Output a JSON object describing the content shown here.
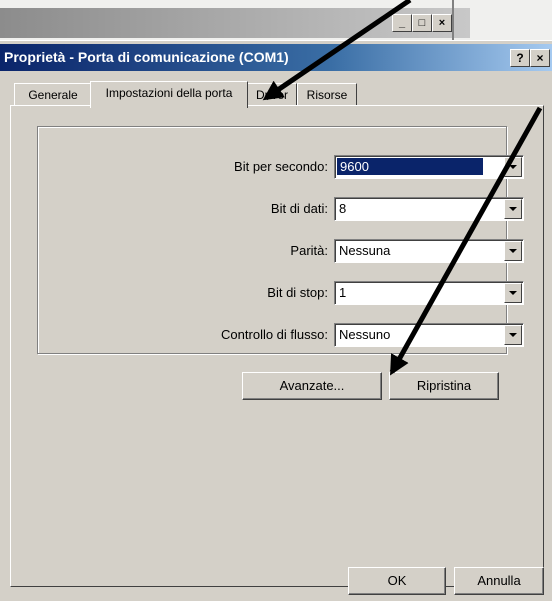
{
  "background_window": {
    "min_label": "_",
    "max_label": "□",
    "close_label": "×"
  },
  "dialog": {
    "title": "Proprietà - Porta di comunicazione (COM1)",
    "help_label": "?",
    "close_label": "×",
    "tabs": [
      {
        "label": "Generale",
        "active": false
      },
      {
        "label": "Impostazioni della porta",
        "active": true
      },
      {
        "label": "Driver",
        "active": false
      },
      {
        "label": "Risorse",
        "active": false
      }
    ],
    "settings": [
      {
        "label": "Bit per secondo:",
        "value": "9600",
        "focused": true
      },
      {
        "label": "Bit di dati:",
        "value": "8",
        "focused": false
      },
      {
        "label": "Parità:",
        "value": "Nessuna",
        "focused": false
      },
      {
        "label": "Bit di stop:",
        "value": "1",
        "focused": false
      },
      {
        "label": "Controllo di flusso:",
        "value": "Nessuno",
        "focused": false
      }
    ],
    "advanced_label": "Avanzate...",
    "restore_label": "Ripristina",
    "ok_label": "OK",
    "cancel_label": "Annulla"
  },
  "annotation_color": "#000000"
}
